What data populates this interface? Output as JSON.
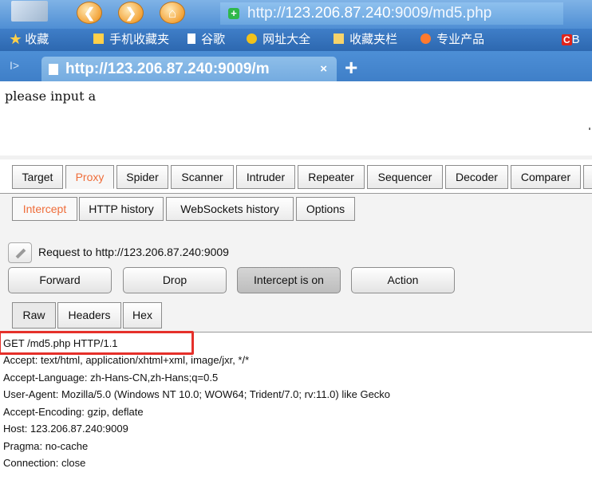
{
  "browser": {
    "nav_buttons": [
      "back-icon",
      "forward-icon",
      "home-icon"
    ],
    "address_bar": {
      "prefix": "http://",
      "host": "123.206.87.240",
      "rest": ":9009/md5.php"
    },
    "bookmarks": [
      {
        "icon": "star-icon",
        "label": "收藏"
      },
      {
        "icon": "phone-icon",
        "label": "手机收藏夹"
      },
      {
        "icon": "page-icon",
        "label": "谷歌"
      },
      {
        "icon": "plus-circle-icon",
        "label": "网址大全"
      },
      {
        "icon": "folder-icon",
        "label": "收藏夹栏"
      },
      {
        "icon": "swirl-icon",
        "label": "专业产品"
      },
      {
        "icon": "c-icon",
        "label": "C",
        "trail": "B"
      }
    ],
    "tab": {
      "title": "http://123.206.87.240:9009/m",
      "close": "×"
    },
    "tab_add": "+",
    "tab_arrow": "I>"
  },
  "page": {
    "text": "please input a"
  },
  "burp": {
    "main_tabs": [
      "Target",
      "Proxy",
      "Spider",
      "Scanner",
      "Intruder",
      "Repeater",
      "Sequencer",
      "Decoder",
      "Comparer"
    ],
    "active_main_tab": "Proxy",
    "proxy_tabs": [
      "Intercept",
      "HTTP history",
      "WebSockets history",
      "Options"
    ],
    "active_proxy_tab": "Intercept",
    "request_to": "Request to http://123.206.87.240:9009",
    "buttons": {
      "forward": "Forward",
      "drop": "Drop",
      "intercept": "Intercept is on",
      "action": "Action"
    },
    "view_tabs": [
      "Raw",
      "Headers",
      "Hex"
    ],
    "active_view_tab": "Raw",
    "request_lines": [
      "GET /md5.php HTTP/1.1",
      "Accept: text/html, application/xhtml+xml, image/jxr, */*",
      "Accept-Language: zh-Hans-CN,zh-Hans;q=0.5",
      "User-Agent: Mozilla/5.0 (Windows NT 10.0; WOW64; Trident/7.0; rv:11.0) like Gecko",
      "Accept-Encoding: gzip, deflate",
      "Host: 123.206.87.240:9009",
      "Pragma: no-cache",
      "Connection: close"
    ],
    "highlight_color": "#e5302a",
    "accent_color": "#ef6d3a"
  }
}
